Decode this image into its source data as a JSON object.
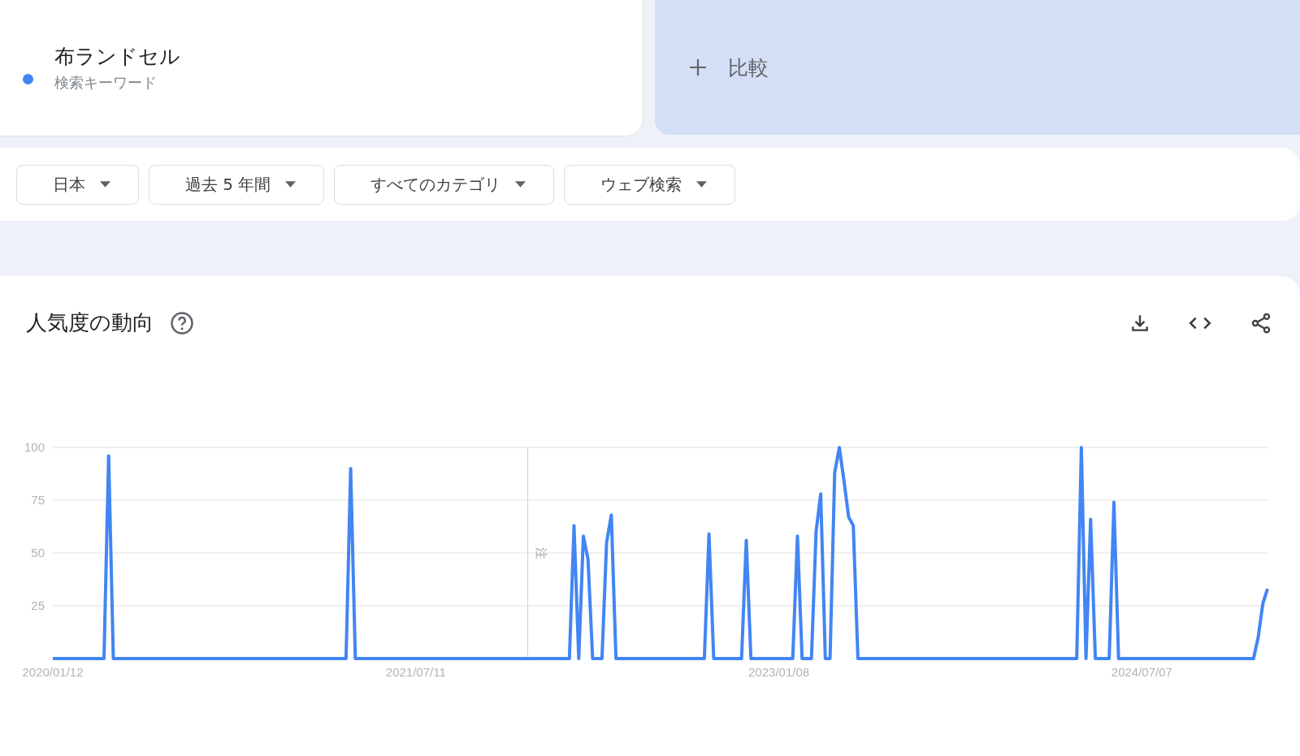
{
  "keyword": {
    "term": "布ランドセル",
    "type_label": "検索キーワード",
    "color": "#4285f4"
  },
  "compare": {
    "label": "比較"
  },
  "filters": [
    {
      "label": "日本"
    },
    {
      "label": "過去 5 年間"
    },
    {
      "label": "すべてのカテゴリ"
    },
    {
      "label": "ウェブ検索"
    }
  ],
  "interest_over_time": {
    "title": "人気度の動向",
    "chart_data": {
      "type": "line",
      "grid": true,
      "ylim": [
        0,
        100
      ],
      "yticks": [
        25,
        50,
        75,
        100
      ],
      "categories": [
        "2020/01/12",
        null,
        null,
        null,
        null,
        null,
        null,
        null,
        null,
        null,
        null,
        null,
        null,
        null,
        null,
        null,
        null,
        null,
        null,
        null,
        null,
        null,
        null,
        null,
        null,
        null,
        null,
        null,
        null,
        null,
        null,
        null,
        null,
        null,
        null,
        null,
        null,
        null,
        null,
        null,
        null,
        null,
        null,
        null,
        null,
        null,
        null,
        null,
        null,
        null,
        null,
        null,
        null,
        null,
        null,
        null,
        null,
        null,
        null,
        null,
        null,
        null,
        null,
        null,
        null,
        null,
        null,
        null,
        null,
        null,
        null,
        null,
        null,
        null,
        null,
        null,
        null,
        null,
        "2021/07/11",
        null,
        null,
        null,
        null,
        null,
        null,
        null,
        null,
        null,
        null,
        null,
        null,
        null,
        null,
        null,
        null,
        null,
        null,
        null,
        null,
        null,
        null,
        null,
        null,
        null,
        null,
        null,
        null,
        null,
        null,
        null,
        null,
        null,
        null,
        null,
        null,
        null,
        null,
        null,
        null,
        null,
        null,
        null,
        null,
        null,
        null,
        null,
        null,
        null,
        null,
        null,
        null,
        null,
        null,
        null,
        null,
        null,
        null,
        null,
        null,
        null,
        null,
        null,
        null,
        null,
        null,
        null,
        null,
        null,
        null,
        null,
        null,
        null,
        null,
        null,
        null,
        null,
        "2023/01/08",
        null,
        null,
        null,
        null,
        null,
        null,
        null,
        null,
        null,
        null,
        null,
        null,
        null,
        null,
        null,
        null,
        null,
        null,
        null,
        null,
        null,
        null,
        null,
        null,
        null,
        null,
        null,
        null,
        null,
        null,
        null,
        null,
        null,
        null,
        null,
        null,
        null,
        null,
        null,
        null,
        null,
        null,
        null,
        null,
        null,
        null,
        null,
        null,
        null,
        null,
        null,
        null,
        null,
        null,
        null,
        null,
        null,
        null,
        null,
        null,
        null,
        null,
        null,
        null,
        null,
        null,
        null,
        null,
        null,
        null,
        null,
        null,
        null,
        null,
        null,
        null,
        null,
        "2024/07/07",
        null,
        null,
        null,
        null,
        null,
        null,
        null,
        null,
        null,
        null,
        null,
        null,
        null,
        null,
        null,
        null,
        null,
        null,
        null,
        null,
        null,
        null,
        null,
        null,
        null,
        null,
        null
      ],
      "series": [
        {
          "color": "#4285f4",
          "values": [
            0,
            0,
            0,
            0,
            0,
            0,
            0,
            0,
            0,
            0,
            0,
            0,
            96,
            0,
            0,
            0,
            0,
            0,
            0,
            0,
            0,
            0,
            0,
            0,
            0,
            0,
            0,
            0,
            0,
            0,
            0,
            0,
            0,
            0,
            0,
            0,
            0,
            0,
            0,
            0,
            0,
            0,
            0,
            0,
            0,
            0,
            0,
            0,
            0,
            0,
            0,
            0,
            0,
            0,
            0,
            0,
            0,
            0,
            0,
            0,
            0,
            0,
            0,
            0,
            90,
            0,
            0,
            0,
            0,
            0,
            0,
            0,
            0,
            0,
            0,
            0,
            0,
            0,
            0,
            0,
            0,
            0,
            0,
            0,
            0,
            0,
            0,
            0,
            0,
            0,
            0,
            0,
            0,
            0,
            0,
            0,
            0,
            0,
            0,
            0,
            0,
            0,
            0,
            0,
            0,
            0,
            0,
            0,
            0,
            0,
            0,
            0,
            63,
            0,
            58,
            47,
            0,
            0,
            0,
            55,
            68,
            0,
            0,
            0,
            0,
            0,
            0,
            0,
            0,
            0,
            0,
            0,
            0,
            0,
            0,
            0,
            0,
            0,
            0,
            0,
            0,
            59,
            0,
            0,
            0,
            0,
            0,
            0,
            0,
            56,
            0,
            0,
            0,
            0,
            0,
            0,
            0,
            0,
            0,
            0,
            58,
            0,
            0,
            0,
            60,
            78,
            0,
            0,
            88,
            100,
            84,
            67,
            63,
            0,
            0,
            0,
            0,
            0,
            0,
            0,
            0,
            0,
            0,
            0,
            0,
            0,
            0,
            0,
            0,
            0,
            0,
            0,
            0,
            0,
            0,
            0,
            0,
            0,
            0,
            0,
            0,
            0,
            0,
            0,
            0,
            0,
            0,
            0,
            0,
            0,
            0,
            0,
            0,
            0,
            0,
            0,
            0,
            0,
            0,
            0,
            0,
            100,
            0,
            66,
            0,
            0,
            0,
            0,
            74,
            0,
            0,
            0,
            0,
            0,
            0,
            0,
            0,
            0,
            0,
            0,
            0,
            0,
            0,
            0,
            0,
            0,
            0,
            0,
            0,
            0,
            0,
            0,
            0,
            0,
            0,
            0,
            0,
            0,
            0,
            10,
            26,
            33
          ]
        }
      ],
      "annotations": [
        "注"
      ]
    }
  }
}
